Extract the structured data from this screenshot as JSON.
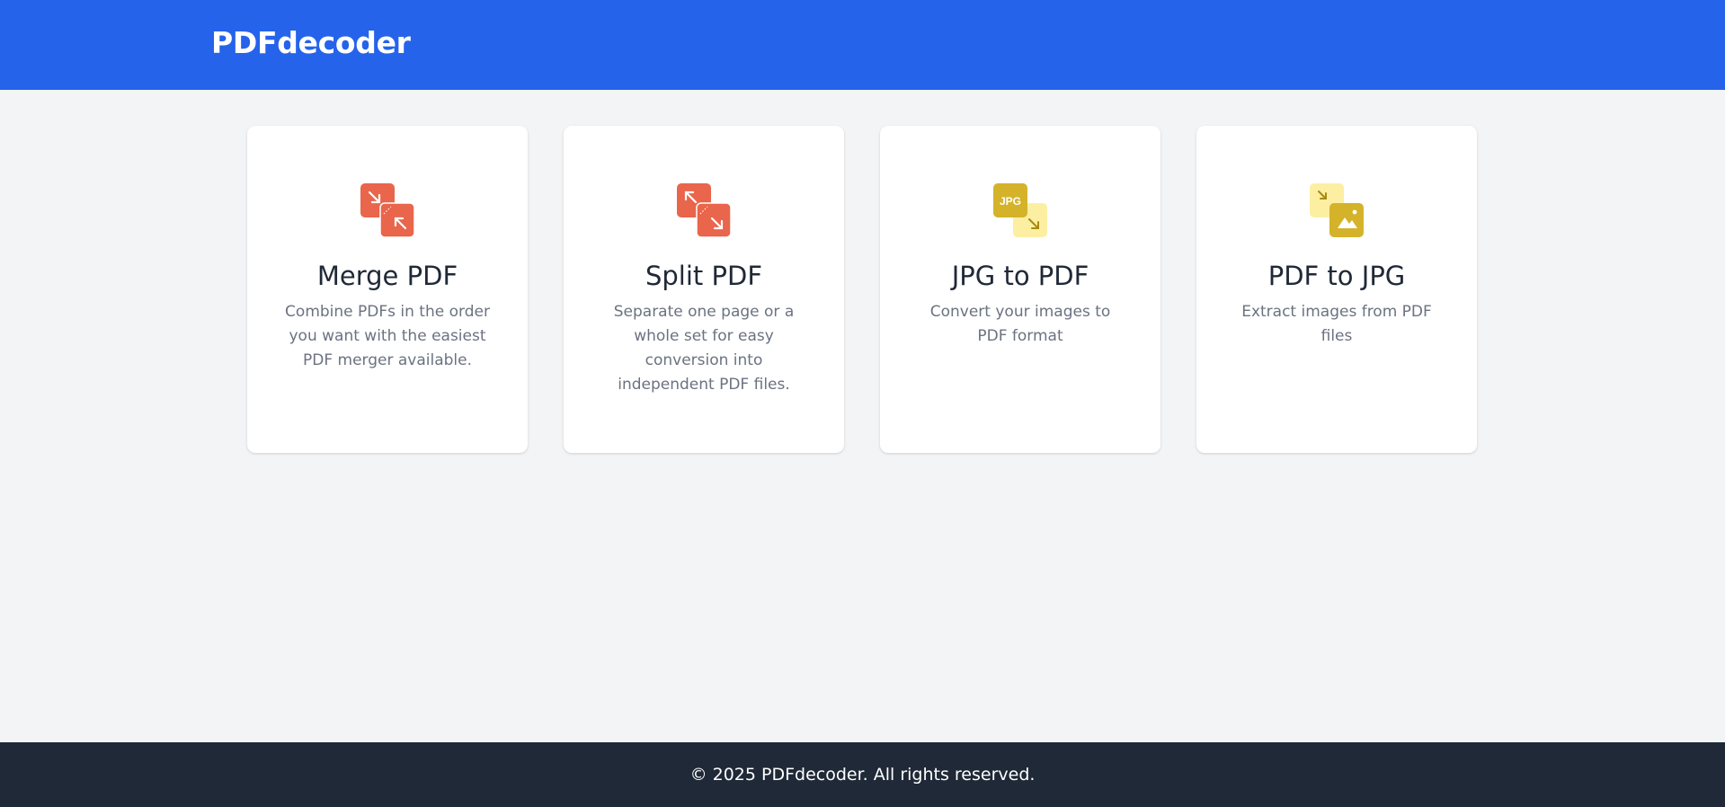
{
  "header": {
    "logo": "PDFdecoder",
    "brand_color": "#2563eb"
  },
  "tools": [
    {
      "title": "Merge PDF",
      "description": "Combine PDFs in the order you want with the easiest PDF merger available.",
      "icon": "merge-pdf-icon",
      "color": "#e9654b"
    },
    {
      "title": "Split PDF",
      "description": "Separate one page or a whole set for easy conversion into independent PDF files.",
      "icon": "split-pdf-icon",
      "color": "#e9654b"
    },
    {
      "title": "JPG to PDF",
      "description": "Convert your images to PDF format",
      "icon": "jpg-to-pdf-icon",
      "icon_text": "JPG",
      "color": "#d4b32a"
    },
    {
      "title": "PDF to JPG",
      "description": "Extract images from PDF files",
      "icon": "pdf-to-jpg-icon",
      "color": "#d4b32a"
    }
  ],
  "footer": {
    "text": "© 2025 PDFdecoder. All rights reserved."
  }
}
